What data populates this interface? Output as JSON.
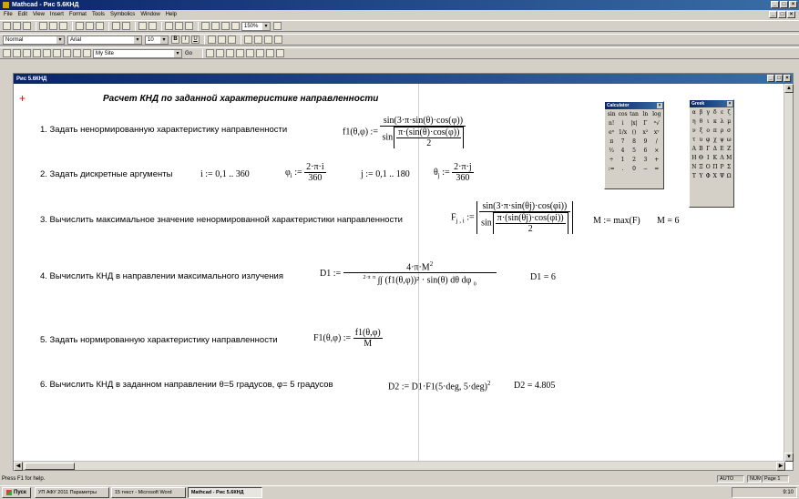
{
  "window": {
    "title": "Mathcad - Рис 5.6КНД"
  },
  "menu": [
    "File",
    "Edit",
    "View",
    "Insert",
    "Format",
    "Tools",
    "Symbolics",
    "Window",
    "Help"
  ],
  "toolbar": {
    "style": "Normal",
    "font": "Arial",
    "size": "10",
    "zoom": "150%",
    "bold": "B",
    "italic": "I",
    "underline": "U",
    "resource": "My Site",
    "go": "Go"
  },
  "document": {
    "title": "Рис 5.6КНД",
    "heading": "Расчет КНД по заданной характеристике направленности",
    "steps": [
      "1. Задать  ненормированную характеристику направленности",
      "2. Задать дискретные аргументы",
      "3. Вычислить максимальное значение ненормированной характеристики направленности",
      "4. Вычислить КНД в направлении максимального излучения",
      "5. Задать нормированную характеристику направленности",
      "6. Вычислить КНД в заданном направлении θ=5 градусов, φ= 5 градусов"
    ],
    "eq": {
      "f1_lhs": "f1(θ,φ) :=",
      "f1_num": "sin(3·π·sin(θ)·cos(φ))",
      "f1_den_sin": "sin",
      "f1_den_num": "π·(sin(θ)·cos(φ))",
      "f1_den_den": "2",
      "i_def": "i := 0,1 .. 360",
      "phi_lhs": "φ",
      "phi_sub": "i",
      "phi_assign": ":=",
      "phi_num": "2·π·i",
      "phi_den": "360",
      "j_def": "j := 0,1 .. 180",
      "theta_lhs": "θ",
      "theta_sub": "j",
      "theta_assign": ":=",
      "theta_num": "2·π·j",
      "theta_den": "360",
      "F_lhs": "F",
      "F_sub": "j , i",
      "F_assign": ":=",
      "F_num": "sin(3·π·sin(θj)·cos(φi))",
      "F_den_sin": "sin",
      "F_den_num": "π·(sin(θj)·cos(φi))",
      "F_den_den": "2",
      "M_def": "M := max(F)",
      "M_result": "M = 6",
      "D1_lhs": "D1 :=",
      "D1_num": "4·π·M",
      "D1_exp": "2",
      "D1_den": "∫∫ (f1(θ,φ))² · sin(θ) dθ dφ",
      "D1_int_outer_up": "2·π",
      "D1_int_inner_up": "π",
      "D1_int_low": "0",
      "D1_result": "D1 = 6",
      "F1_lhs": "F1(θ,φ) :=",
      "F1_num": "f1(θ,φ)",
      "F1_den": "M",
      "D2_def": "D2 := D1·F1(5·deg, 5·deg)",
      "D2_exp": "2",
      "D2_result": "D2 = 4.805"
    }
  },
  "calculator": {
    "title": "Calculator",
    "keys": [
      "sin",
      "cos",
      "tan",
      "ln",
      "log",
      "n!",
      "i",
      "|x|",
      "Γ",
      "ⁿ√",
      "eˣ",
      "1/x",
      "()",
      "x²",
      "xʸ",
      "π",
      "7",
      "8",
      "9",
      "/",
      "⅟₂",
      "4",
      "5",
      "6",
      "×",
      "÷",
      "1",
      "2",
      "3",
      "+",
      ":=",
      ".",
      "0",
      "−",
      "="
    ]
  },
  "greek": {
    "title": "Greek",
    "keys": [
      "α",
      "β",
      "γ",
      "δ",
      "ε",
      "ζ",
      "η",
      "θ",
      "ι",
      "κ",
      "λ",
      "μ",
      "ν",
      "ξ",
      "ο",
      "π",
      "ρ",
      "σ",
      "τ",
      "υ",
      "φ",
      "χ",
      "ψ",
      "ω",
      "Α",
      "Β",
      "Γ",
      "Δ",
      "Ε",
      "Ζ",
      "Η",
      "Θ",
      "Ι",
      "Κ",
      "Λ",
      "Μ",
      "Ν",
      "Ξ",
      "Ο",
      "Π",
      "Ρ",
      "Σ",
      "Τ",
      "Υ",
      "Φ",
      "Χ",
      "Ψ",
      "Ω"
    ]
  },
  "status": {
    "help": "Press F1 for help.",
    "auto": "AUTO",
    "num": "NUM",
    "page": "Page 1"
  },
  "taskbar": {
    "start": "Пуск",
    "tasks": [
      "УП АФУ 2011 Параметры",
      "15 текст - Microsoft Word",
      "Mathcad - Рис 5.6КНД"
    ],
    "clock": "9:10"
  }
}
